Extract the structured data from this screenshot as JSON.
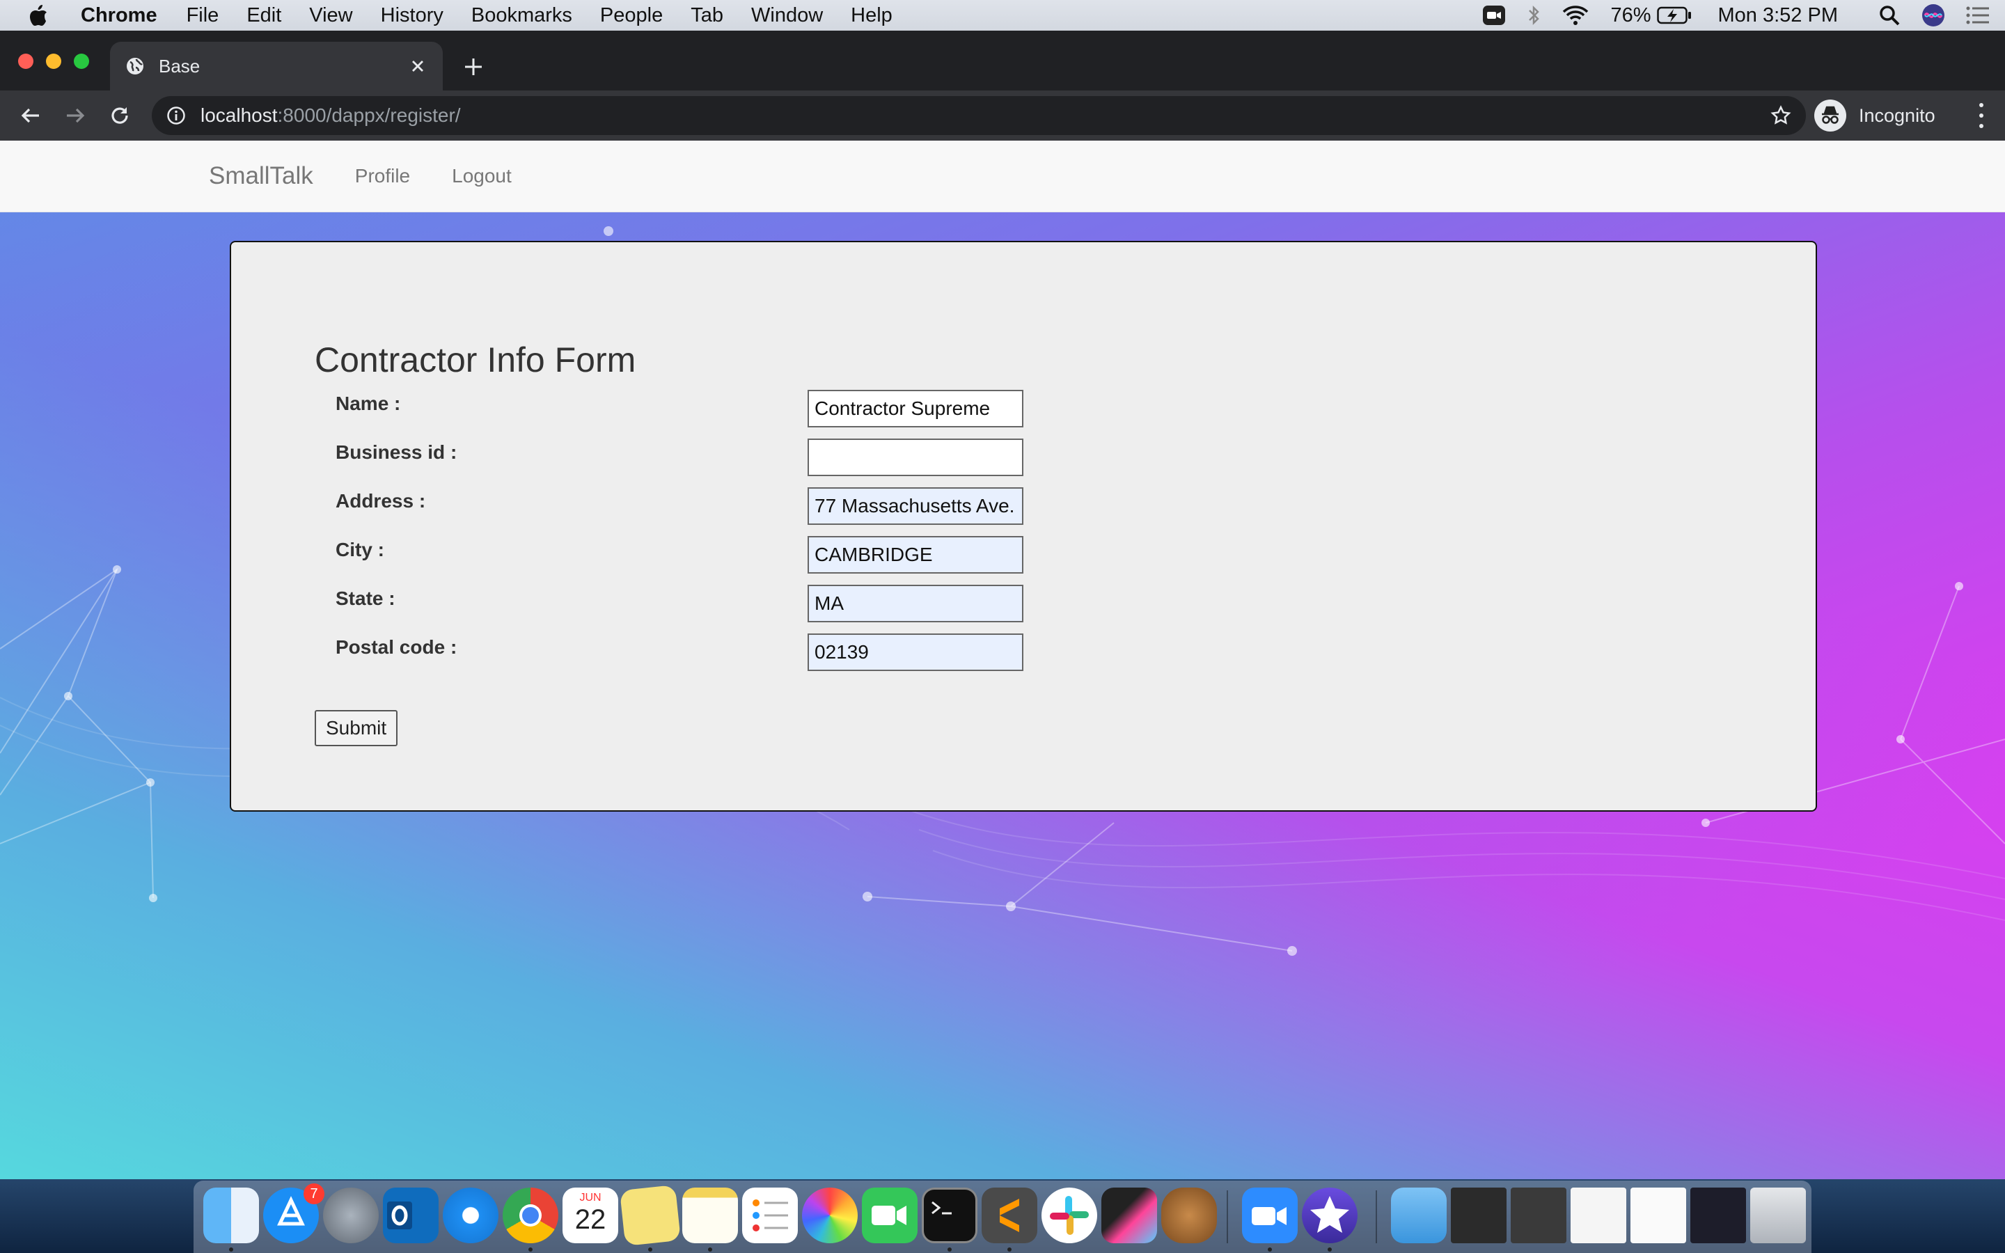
{
  "menubar": {
    "app_name": "Chrome",
    "items": [
      "File",
      "Edit",
      "View",
      "History",
      "Bookmarks",
      "People",
      "Tab",
      "Window",
      "Help"
    ],
    "battery": "76%",
    "clock": "Mon 3:52 PM"
  },
  "browser": {
    "tab_title": "Base",
    "url_host": "localhost",
    "url_path": ":8000/dappx/register/",
    "profile_label": "Incognito"
  },
  "site": {
    "brand": "SmallTalk",
    "nav": [
      "Profile",
      "Logout"
    ]
  },
  "form": {
    "title": "Contractor Info Form",
    "fields": [
      {
        "label": "Name :",
        "value": "Contractor Supreme",
        "autofilled": false
      },
      {
        "label": "Business id :",
        "value": "",
        "autofilled": false
      },
      {
        "label": "Address :",
        "value": "77 Massachusetts Ave.",
        "autofilled": true
      },
      {
        "label": "City :",
        "value": "CAMBRIDGE",
        "autofilled": true
      },
      {
        "label": "State :",
        "value": "MA",
        "autofilled": true
      },
      {
        "label": "Postal code :",
        "value": "02139",
        "autofilled": true
      }
    ],
    "submit_label": "Submit"
  },
  "dock": {
    "calendar_month": "JUN",
    "calendar_day": "22",
    "appstore_badge": "7",
    "apps": [
      "finder-icon",
      "app-store-icon",
      "launchpad-icon",
      "outlook-icon",
      "safari-icon",
      "chrome-icon",
      "calendar-icon",
      "stickies-icon",
      "notes-icon",
      "reminders-icon",
      "photos-icon",
      "facetime-icon",
      "terminal-icon",
      "sublime-text-icon",
      "slack-icon",
      "final-cut-icon",
      "cyberduck-icon",
      "zoom-icon",
      "imovie-icon",
      "downloads-folder-icon",
      "window-thumbnail",
      "window-thumbnail",
      "window-thumbnail",
      "window-thumbnail",
      "window-thumbnail",
      "trash-icon"
    ]
  },
  "colors": {
    "autofill_bg": "#e8f0fe",
    "chrome_dark": "#202124",
    "navbar_bg": "#f8f8f8",
    "panel_bg": "#eeeeee"
  }
}
